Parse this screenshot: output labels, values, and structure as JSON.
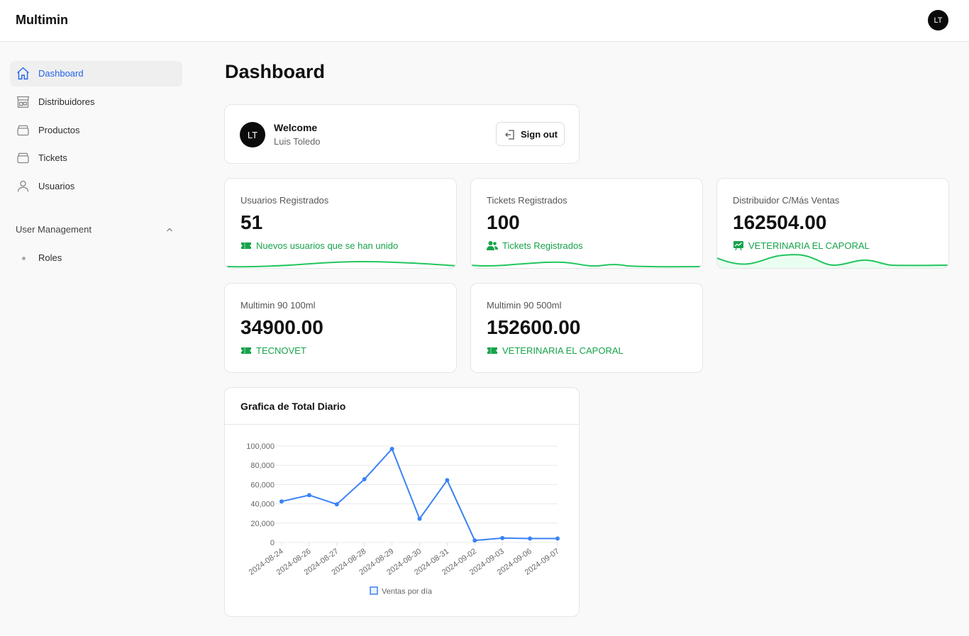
{
  "app": {
    "brand": "Multimin",
    "user_initials": "LT"
  },
  "sidebar": {
    "items": [
      {
        "label": "Dashboard",
        "icon": "home-icon",
        "active": true
      },
      {
        "label": "Distribuidores",
        "icon": "store-icon",
        "active": false
      },
      {
        "label": "Productos",
        "icon": "box-icon",
        "active": false
      },
      {
        "label": "Tickets",
        "icon": "box-icon",
        "active": false
      },
      {
        "label": "Usuarios",
        "icon": "user-icon",
        "active": false
      }
    ],
    "section": {
      "label": "User Management",
      "expanded": true,
      "items": [
        {
          "label": "Roles"
        }
      ]
    }
  },
  "main": {
    "title": "Dashboard",
    "welcome": {
      "title": "Welcome",
      "name": "Luis Toledo",
      "initials": "LT",
      "signout_label": "Sign out"
    },
    "stats": [
      {
        "label": "Usuarios Registrados",
        "value": "51",
        "sub": "Nuevos usuarios que se han unido",
        "icon": "ticket-icon"
      },
      {
        "label": "Tickets Registrados",
        "value": "100",
        "sub": "Tickets Registrados",
        "icon": "users-icon"
      },
      {
        "label": "Distribuidor C/Más Ventas",
        "value": "162504.00",
        "sub": "VETERINARIA EL CAPORAL",
        "icon": "chart-up-icon"
      },
      {
        "label": "Multimin 90 100ml",
        "value": "34900.00",
        "sub": "TECNOVET",
        "icon": "ticket-icon"
      },
      {
        "label": "Multimin 90 500ml",
        "value": "152600.00",
        "sub": "VETERINARIA EL CAPORAL",
        "icon": "ticket-icon"
      }
    ],
    "chart_card": {
      "title": "Grafica de Total Diario"
    }
  },
  "colors": {
    "accent": "#2563eb",
    "success": "#16a34a",
    "line": "#3b82f6",
    "spark": "#22c55e"
  },
  "chart_data": {
    "type": "line",
    "title": "",
    "xlabel": "",
    "ylabel": "",
    "categories": [
      "2024-08-24",
      "2024-08-26",
      "2024-08-27",
      "2024-08-28",
      "2024-08-29",
      "2024-08-30",
      "2024-08-31",
      "2024-09-02",
      "2024-09-03",
      "2024-09-06",
      "2024-09-07"
    ],
    "series": [
      {
        "name": "Ventas por día",
        "values": [
          42500,
          49000,
          39500,
          65500,
          97000,
          24500,
          64500,
          2000,
          4500,
          4000,
          4000
        ]
      }
    ],
    "ylim": [
      0,
      100000
    ],
    "yticks": [
      "0",
      "20,000",
      "40,000",
      "60,000",
      "80,000",
      "100,000"
    ],
    "grid": true,
    "legend": "bottom"
  }
}
